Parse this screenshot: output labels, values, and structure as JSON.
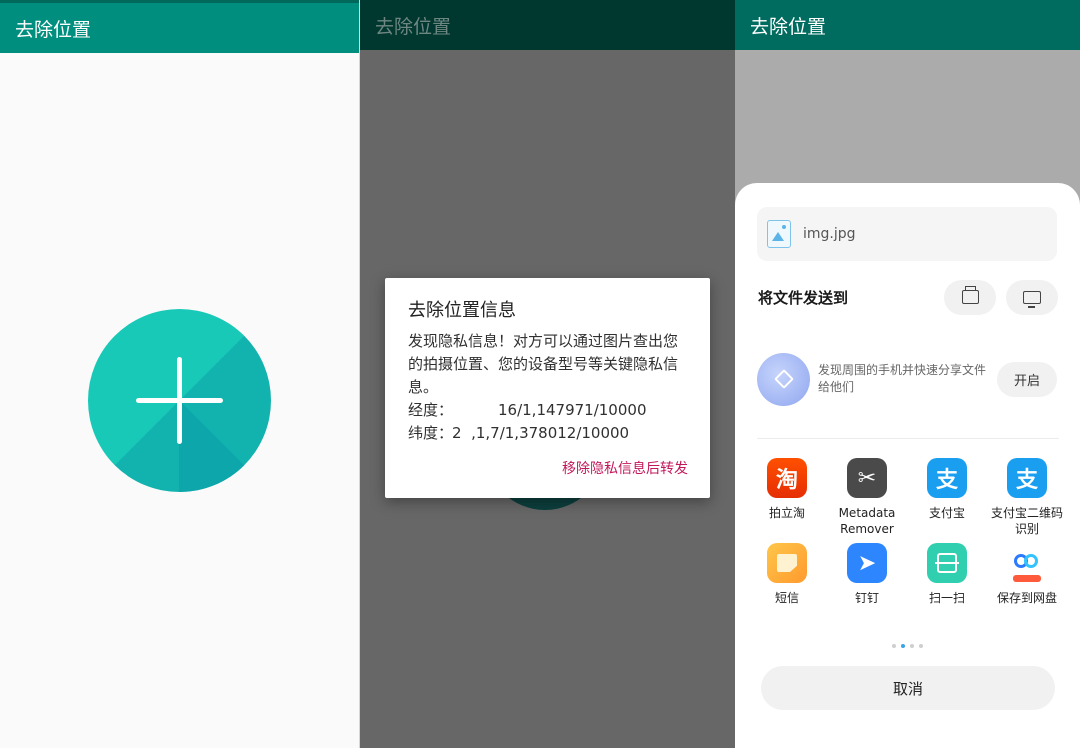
{
  "panel1": {
    "title": "去除位置",
    "fab_icon": "plus-icon"
  },
  "panel2": {
    "title": "去除位置",
    "dialog": {
      "title": "去除位置信息",
      "message": "发现隐私信息！对方可以通过图片查出您的拍摄位置、您的设备型号等关键隐私信息。",
      "longitude_label": "经度：",
      "longitude_value": "16/1,147971/10000",
      "latitude_label": "纬度：",
      "latitude_value": "2  ,1,7/1,378012/10000",
      "action": "移除隐私信息后转发"
    }
  },
  "panel3": {
    "title": "去除位置",
    "file_name": "img.jpg",
    "send_to": "将文件发送到",
    "nearby_text": "发现周围的手机并快速分享文件给他们",
    "enable_label": "开启",
    "apps": [
      {
        "label": "拍立淘",
        "icon": "taobao-icon",
        "glyph": "淘"
      },
      {
        "label": "Metadata Remover",
        "icon": "scissors-icon",
        "glyph": "✂"
      },
      {
        "label": "支付宝",
        "icon": "alipay-icon",
        "glyph": "支"
      },
      {
        "label": "支付宝二维码识别",
        "icon": "alipay-icon",
        "glyph": "支"
      },
      {
        "label": "短信",
        "icon": "sms-icon",
        "glyph": ""
      },
      {
        "label": "钉钉",
        "icon": "dingtalk-icon",
        "glyph": "➤"
      },
      {
        "label": "扫一扫",
        "icon": "scan-icon",
        "glyph": ""
      },
      {
        "label": "保存到网盘",
        "icon": "cloud-drive-icon",
        "glyph": ""
      }
    ],
    "page_count": 4,
    "active_page": 1,
    "cancel_label": "取消"
  },
  "colors": {
    "appbar": "#008f7e",
    "fab": "#17c9b6",
    "dialog_action": "#c2185b"
  }
}
